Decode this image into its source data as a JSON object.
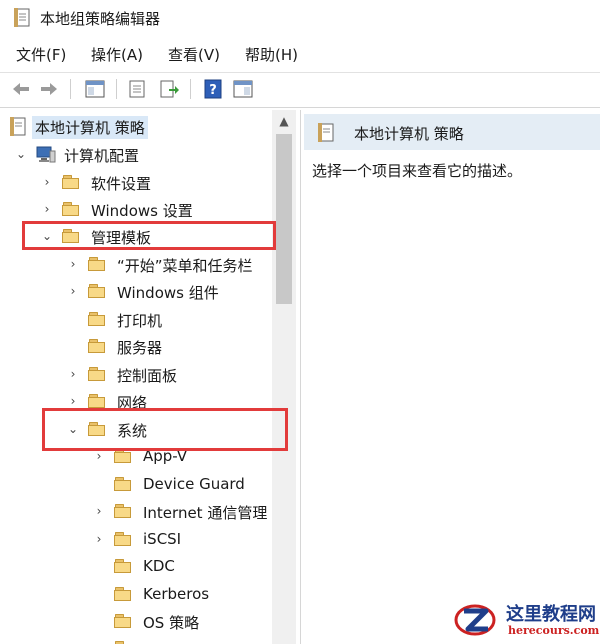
{
  "window": {
    "title": "本地组策略编辑器"
  },
  "menu": {
    "items": [
      "文件(F)",
      "操作(A)",
      "查看(V)",
      "帮助(H)"
    ]
  },
  "toolbar": {
    "buttons": [
      "back-icon",
      "forward-icon",
      "show-hide-tree-icon",
      "properties-icon",
      "export-list-icon",
      "help-icon",
      "show-hide-action-pane-icon"
    ]
  },
  "tree": {
    "root": "本地计算机 策略",
    "computer_config": "计算机配置",
    "software_settings": "软件设置",
    "windows_settings": "Windows 设置",
    "admin_templates": "管理模板",
    "start_menu": "“开始”菜单和任务栏",
    "windows_components": "Windows 组件",
    "printers": "打印机",
    "server": "服务器",
    "control_panel": "控制面板",
    "network": "网络",
    "system": "系统",
    "app_v": "App-V",
    "device_guard": "Device Guard",
    "internet_comm": "Internet 通信管理",
    "iscsi": "iSCSI",
    "kdc": "KDC",
    "kerberos": "Kerberos",
    "os_policy": "OS 策略"
  },
  "details": {
    "header_title": "本地计算机 策略",
    "description": "选择一个项目来查看它的描述。"
  },
  "watermark": {
    "name": "这里教程网",
    "url": "herecours.com"
  },
  "colors": {
    "highlight": "#e23b3b",
    "selection": "#d9e8f7",
    "folder": "#f8d987"
  }
}
